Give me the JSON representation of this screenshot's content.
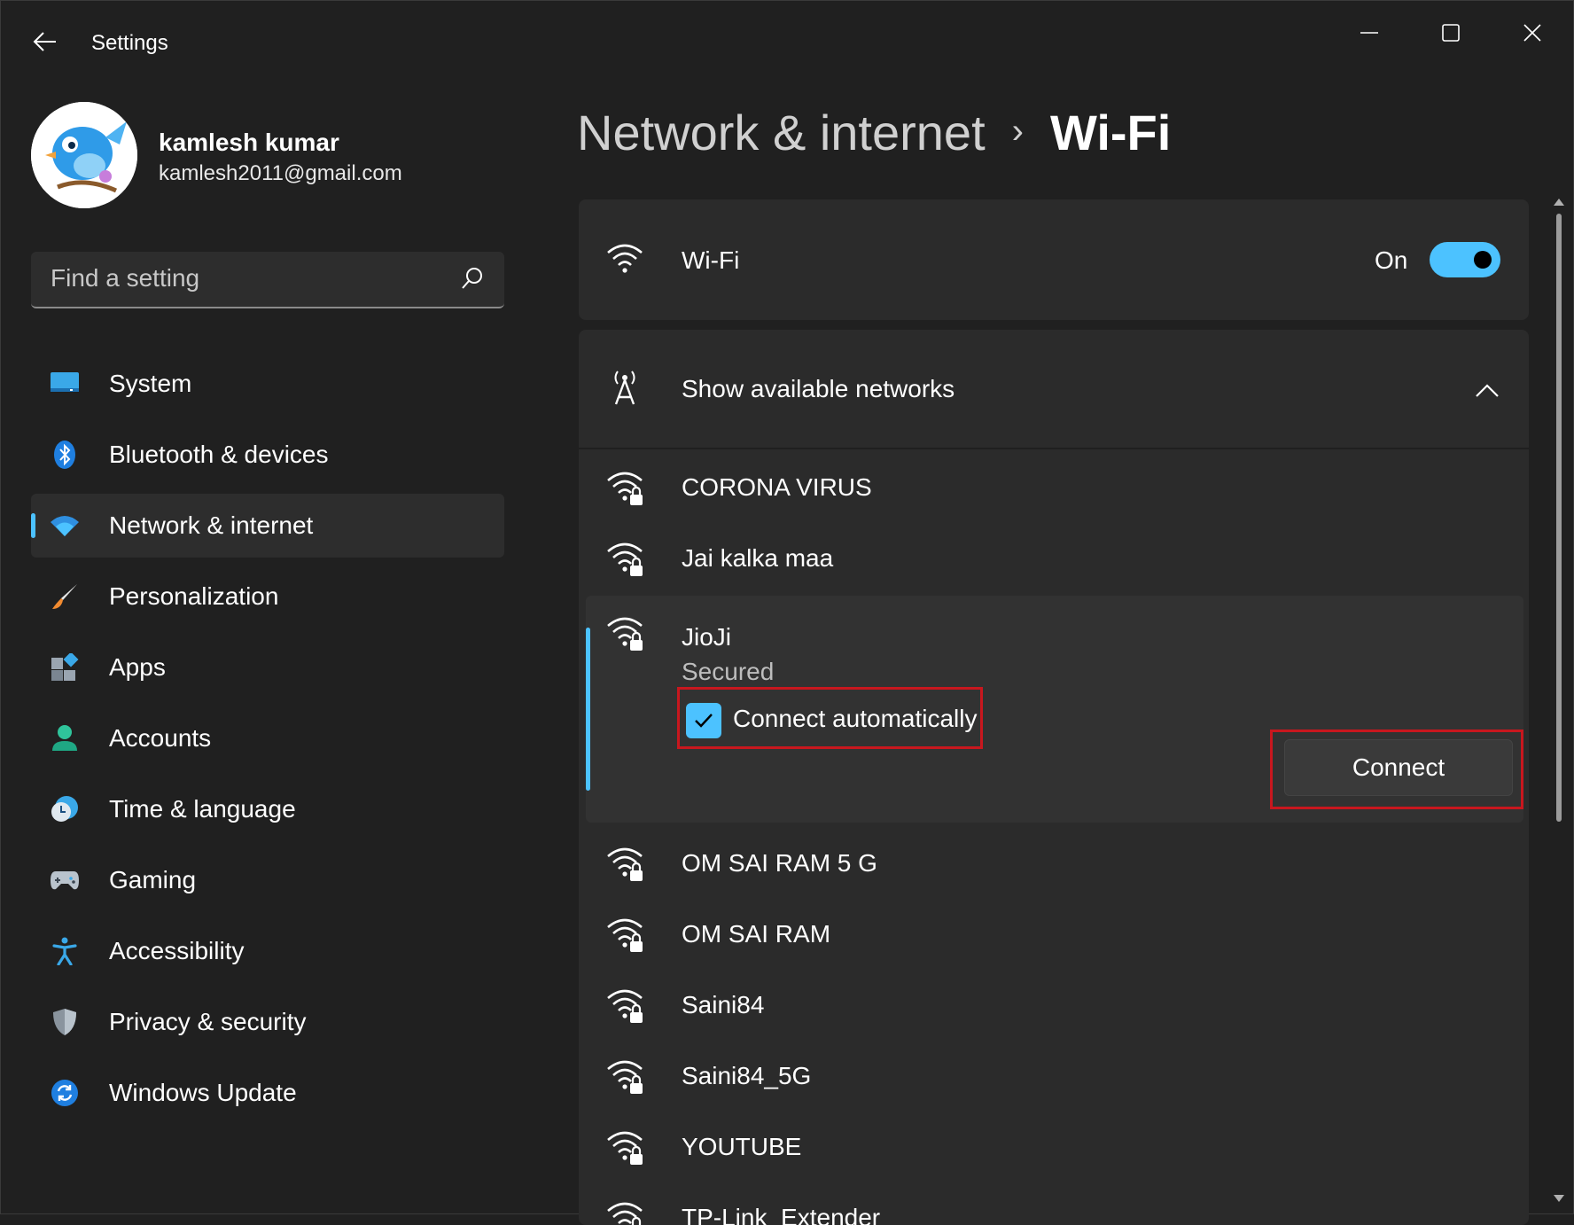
{
  "window": {
    "title": "Settings"
  },
  "user": {
    "name": "kamlesh kumar",
    "email": "kamlesh2011@gmail.com"
  },
  "search": {
    "placeholder": "Find a setting"
  },
  "nav": {
    "items": [
      {
        "label": "System",
        "icon": "monitor-icon"
      },
      {
        "label": "Bluetooth & devices",
        "icon": "bluetooth-icon"
      },
      {
        "label": "Network & internet",
        "icon": "wifi-icon",
        "active": true
      },
      {
        "label": "Personalization",
        "icon": "brush-icon"
      },
      {
        "label": "Apps",
        "icon": "apps-icon"
      },
      {
        "label": "Accounts",
        "icon": "person-icon"
      },
      {
        "label": "Time & language",
        "icon": "clock-globe-icon"
      },
      {
        "label": "Gaming",
        "icon": "gamepad-icon"
      },
      {
        "label": "Accessibility",
        "icon": "accessibility-icon"
      },
      {
        "label": "Privacy & security",
        "icon": "shield-icon"
      },
      {
        "label": "Windows Update",
        "icon": "update-icon"
      }
    ]
  },
  "header": {
    "parent": "Network & internet",
    "separator": "›",
    "current": "Wi-Fi"
  },
  "wifi": {
    "label": "Wi-Fi",
    "state_label": "On",
    "enabled": true
  },
  "available": {
    "label": "Show available networks"
  },
  "networks": [
    {
      "name": "CORONA VIRUS"
    },
    {
      "name": "Jai kalka maa"
    },
    {
      "name": "JioJi",
      "status": "Secured",
      "expanded": true,
      "connect_auto_label": "Connect automatically",
      "connect_auto": true,
      "connect_label": "Connect"
    },
    {
      "name": "OM SAI RAM 5 G"
    },
    {
      "name": "OM SAI RAM"
    },
    {
      "name": "Saini84"
    },
    {
      "name": "Saini84_5G"
    },
    {
      "name": "YOUTUBE"
    },
    {
      "name": "TP-Link_Extender"
    }
  ],
  "colors": {
    "accent": "#4cc2ff",
    "highlight": "#c8171e",
    "background": "#202020",
    "card": "#2b2b2b"
  }
}
